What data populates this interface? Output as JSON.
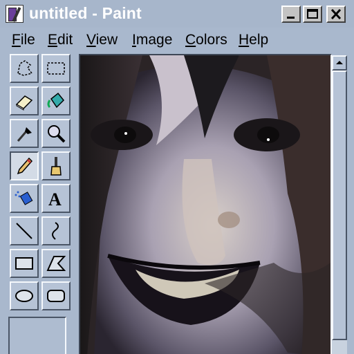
{
  "window": {
    "title": "untitled - Paint"
  },
  "controls": {
    "minimize": "minimize-icon",
    "maximize": "maximize-icon",
    "close": "close-icon"
  },
  "menu": [
    "File",
    "Edit",
    "View",
    "Image",
    "Colors",
    "Help"
  ],
  "tools": [
    {
      "name": "free-form-select-icon"
    },
    {
      "name": "rect-select-icon"
    },
    {
      "name": "eraser-icon"
    },
    {
      "name": "fill-bucket-icon"
    },
    {
      "name": "color-picker-icon"
    },
    {
      "name": "magnifier-icon"
    },
    {
      "name": "pencil-icon",
      "active": true
    },
    {
      "name": "brush-icon"
    },
    {
      "name": "airbrush-icon"
    },
    {
      "name": "text-icon",
      "glyph": "A"
    },
    {
      "name": "line-icon"
    },
    {
      "name": "curve-icon"
    },
    {
      "name": "rectangle-icon"
    },
    {
      "name": "polygon-icon"
    },
    {
      "name": "ellipse-icon"
    },
    {
      "name": "rounded-rect-icon"
    }
  ],
  "colors": {
    "frame": "#a9b8cd",
    "title_text": "#ffffff",
    "button_face": "#b6c3d6"
  }
}
